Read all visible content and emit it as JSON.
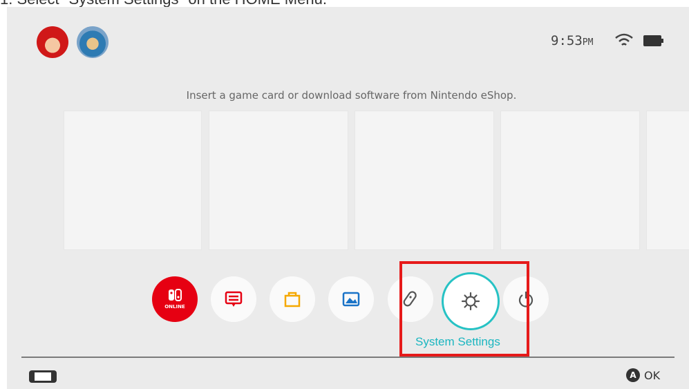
{
  "caption": "1. Select \"System Settings\" on the HOME Menu.",
  "status": {
    "time": "9:53",
    "ampm": "PM",
    "wifi_icon": "wifi-icon",
    "battery_icon": "battery-icon"
  },
  "users": [
    {
      "name": "mario-avatar"
    },
    {
      "name": "link-avatar"
    }
  ],
  "message": "Insert a game card or download software from Nintendo eShop.",
  "apps": {
    "online_label": "ONLINE",
    "items": [
      "nintendo-online-icon",
      "news-icon",
      "eshop-icon",
      "album-icon",
      "controllers-icon",
      "system-settings-icon",
      "sleep-mode-icon"
    ]
  },
  "selected_label": "System Settings",
  "footer": {
    "ok_label": "OK",
    "a_button": "A"
  },
  "colors": {
    "accent": "#26c2c4",
    "online_red": "#e60012",
    "highlight": "#e61a1a"
  }
}
